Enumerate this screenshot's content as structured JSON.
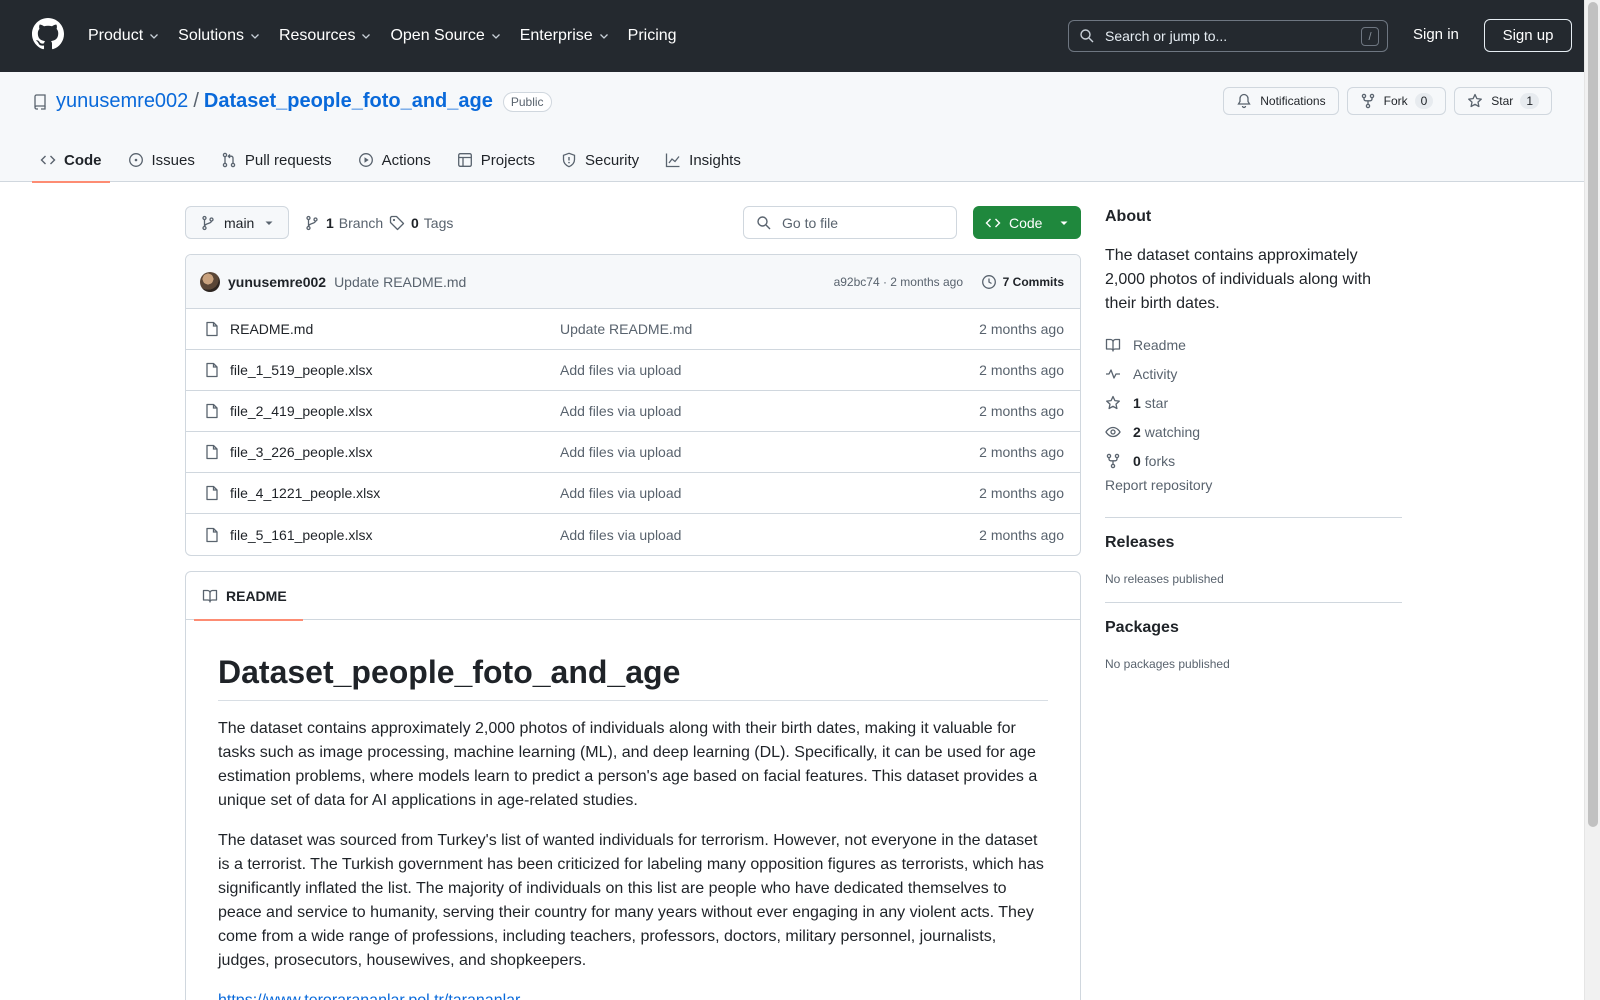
{
  "header": {
    "nav": [
      "Product",
      "Solutions",
      "Resources",
      "Open Source",
      "Enterprise",
      "Pricing"
    ],
    "search_placeholder": "Search or jump to...",
    "search_shortcut": "/",
    "sign_in": "Sign in",
    "sign_up": "Sign up"
  },
  "repo": {
    "owner": "yunusemre002",
    "separator": "/",
    "name": "Dataset_people_foto_and_age",
    "visibility": "Public",
    "notifications_label": "Notifications",
    "fork_label": "Fork",
    "fork_count": "0",
    "star_label": "Star",
    "star_count": "1"
  },
  "tabs": [
    "Code",
    "Issues",
    "Pull requests",
    "Actions",
    "Projects",
    "Security",
    "Insights"
  ],
  "toolbar": {
    "branch": "main",
    "branch_count": "1",
    "branch_label": "Branch",
    "tag_count": "0",
    "tag_label": "Tags",
    "goto_placeholder": "Go to file",
    "code_label": "Code"
  },
  "latest_commit": {
    "author": "yunusemre002",
    "message": "Update README.md",
    "sha_time": "a92bc74 · 2 months ago",
    "commits": "7 Commits"
  },
  "files": [
    {
      "name": "README.md",
      "message": "Update README.md",
      "age": "2 months ago"
    },
    {
      "name": "file_1_519_people.xlsx",
      "message": "Add files via upload",
      "age": "2 months ago"
    },
    {
      "name": "file_2_419_people.xlsx",
      "message": "Add files via upload",
      "age": "2 months ago"
    },
    {
      "name": "file_3_226_people.xlsx",
      "message": "Add files via upload",
      "age": "2 months ago"
    },
    {
      "name": "file_4_1221_people.xlsx",
      "message": "Add files via upload",
      "age": "2 months ago"
    },
    {
      "name": "file_5_161_people.xlsx",
      "message": "Add files via upload",
      "age": "2 months ago"
    }
  ],
  "readme": {
    "tab_label": "README",
    "title": "Dataset_people_foto_and_age",
    "para1": "The dataset contains approximately 2,000 photos of individuals along with their birth dates, making it valuable for tasks such as image processing, machine learning (ML), and deep learning (DL). Specifically, it can be used for age estimation problems, where models learn to predict a person's age based on facial features. This dataset provides a unique set of data for AI applications in age-related studies.",
    "para2": "The dataset was sourced from Turkey's list of wanted individuals for terrorism. However, not everyone in the dataset is a terrorist. The Turkish government has been criticized for labeling many opposition figures as terrorists, which has significantly inflated the list. The majority of individuals on this list are people who have dedicated themselves to peace and service to humanity, serving their country for many years without ever engaging in any violent acts. They come from a wide range of professions, including teachers, professors, doctors, military personnel, journalists, judges, prosecutors, housewives, and shopkeepers.",
    "link": "https://www.terorarananlar.pol.tr/tarananlar"
  },
  "sidebar": {
    "about_title": "About",
    "about_desc": "The dataset contains approximately 2,000 photos of individuals along with their birth dates.",
    "readme": "Readme",
    "activity": "Activity",
    "stars_count": "1",
    "stars_label": "star",
    "watching_count": "2",
    "watching_label": "watching",
    "forks_count": "0",
    "forks_label": "forks",
    "report": "Report repository",
    "releases_title": "Releases",
    "releases_empty": "No releases published",
    "packages_title": "Packages",
    "packages_empty": "No packages published"
  },
  "colors": {
    "header_bg": "#24292f",
    "link": "#0969da",
    "primary_button": "#1f883d",
    "tab_underline": "#fd8c73"
  }
}
